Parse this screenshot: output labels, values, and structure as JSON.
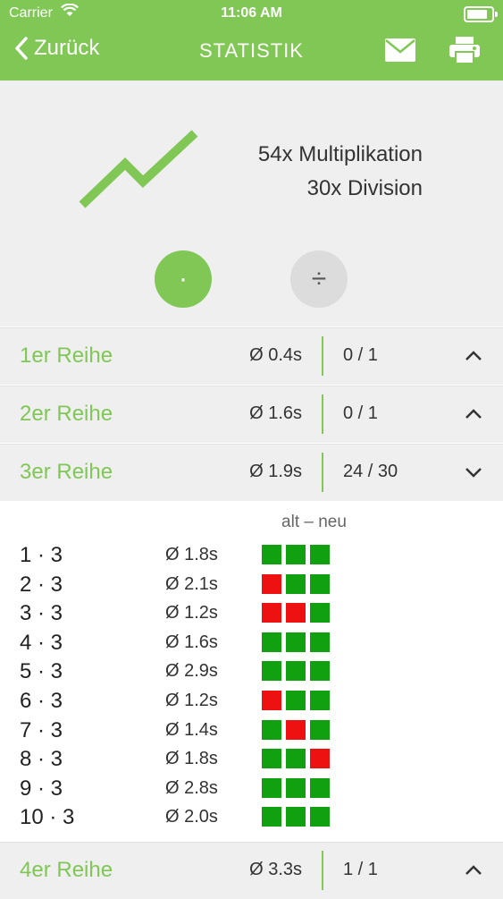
{
  "status_bar": {
    "carrier": "Carrier",
    "time": "11:06 AM"
  },
  "nav": {
    "back_label": "Zurück",
    "title": "STATISTIK",
    "icons": [
      "mail-icon",
      "print-icon"
    ]
  },
  "summary": {
    "multiplication": "54x Multiplikation",
    "division": "30x Division",
    "mul_symbol": "·",
    "div_symbol": "÷"
  },
  "sections": [
    {
      "name": "1er Reihe",
      "avg": "Ø 0.4s",
      "score": "0 / 1",
      "expanded": false
    },
    {
      "name": "2er Reihe",
      "avg": "Ø 1.6s",
      "score": "0 / 1",
      "expanded": false
    },
    {
      "name": "3er Reihe",
      "avg": "Ø 1.9s",
      "score": "24 / 30",
      "expanded": true
    },
    {
      "name": "4er Reihe",
      "avg": "Ø 3.3s",
      "score": "1 / 1",
      "expanded": false
    }
  ],
  "detail": {
    "legend": "alt – neu",
    "rows": [
      {
        "eq": "1 · 3",
        "time": "Ø 1.8s",
        "results": [
          "g",
          "g",
          "g"
        ]
      },
      {
        "eq": "2 · 3",
        "time": "Ø 2.1s",
        "results": [
          "r",
          "g",
          "g"
        ]
      },
      {
        "eq": "3 · 3",
        "time": "Ø 1.2s",
        "results": [
          "r",
          "r",
          "g"
        ]
      },
      {
        "eq": "4 · 3",
        "time": "Ø 1.6s",
        "results": [
          "g",
          "g",
          "g"
        ]
      },
      {
        "eq": "5 · 3",
        "time": "Ø 2.9s",
        "results": [
          "g",
          "g",
          "g"
        ]
      },
      {
        "eq": "6 · 3",
        "time": "Ø 1.2s",
        "results": [
          "r",
          "g",
          "g"
        ]
      },
      {
        "eq": "7 · 3",
        "time": "Ø 1.4s",
        "results": [
          "g",
          "r",
          "g"
        ]
      },
      {
        "eq": "8 · 3",
        "time": "Ø 1.8s",
        "results": [
          "g",
          "g",
          "r"
        ]
      },
      {
        "eq": "9 · 3",
        "time": "Ø 2.8s",
        "results": [
          "g",
          "g",
          "g"
        ]
      },
      {
        "eq": "10 · 3",
        "time": "Ø 2.0s",
        "results": [
          "g",
          "g",
          "g"
        ]
      }
    ]
  },
  "colors": {
    "accent": "#80c756",
    "correct": "#10a010",
    "wrong": "#ee1111"
  }
}
